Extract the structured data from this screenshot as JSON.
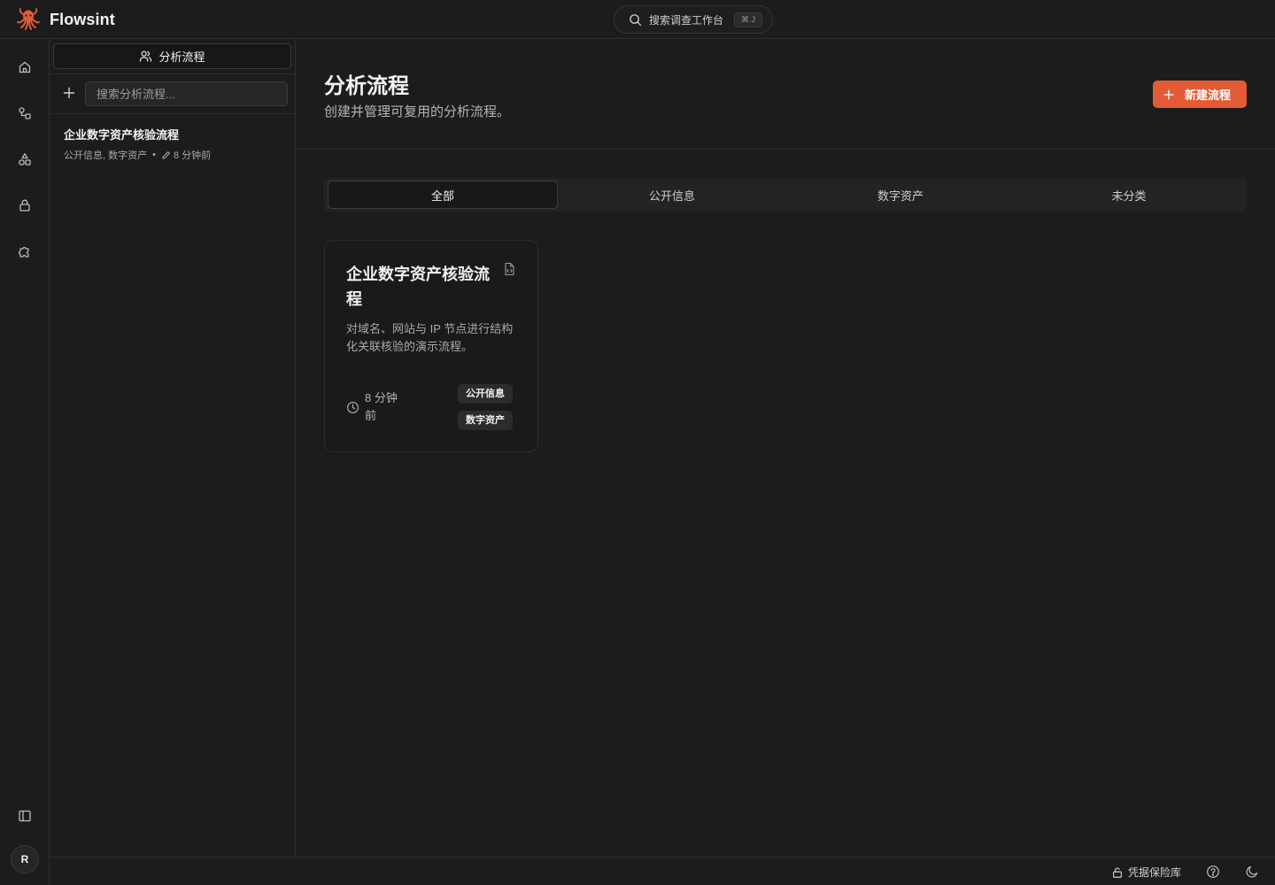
{
  "app": {
    "name": "Flowsint"
  },
  "search": {
    "label": "搜索调查工作台",
    "shortcut": "⌘ J"
  },
  "rail": {
    "items": [
      {
        "icon": "home-icon"
      },
      {
        "icon": "flows-icon"
      },
      {
        "icon": "shapes-icon"
      },
      {
        "icon": "lock-icon"
      },
      {
        "icon": "puzzle-icon"
      }
    ],
    "avatar_initial": "R"
  },
  "panel": {
    "tab_label": "分析流程",
    "search_placeholder": "搜索分析流程...",
    "items": [
      {
        "title": "企业数字资产核验流程",
        "tags": "公开信息, 数字资产",
        "separator": "•",
        "updated": "8 分钟前"
      }
    ]
  },
  "main": {
    "title": "分析流程",
    "subtitle": "创建并管理可复用的分析流程。",
    "new_button": "新建流程",
    "tabs": [
      {
        "label": "全部",
        "active": true
      },
      {
        "label": "公开信息",
        "active": false
      },
      {
        "label": "数字资产",
        "active": false
      },
      {
        "label": "未分类",
        "active": false
      }
    ],
    "cards": [
      {
        "title": "企业数字资产核验流程",
        "description": "对域名、网站与 IP 节点进行结构化关联核验的演示流程。",
        "time": "8 分钟前",
        "tags": [
          "公开信息",
          "数字资产"
        ]
      }
    ]
  },
  "statusbar": {
    "vault_label": "凭据保险库"
  },
  "colors": {
    "accent": "#e35b35",
    "background": "#1c1c1c"
  }
}
